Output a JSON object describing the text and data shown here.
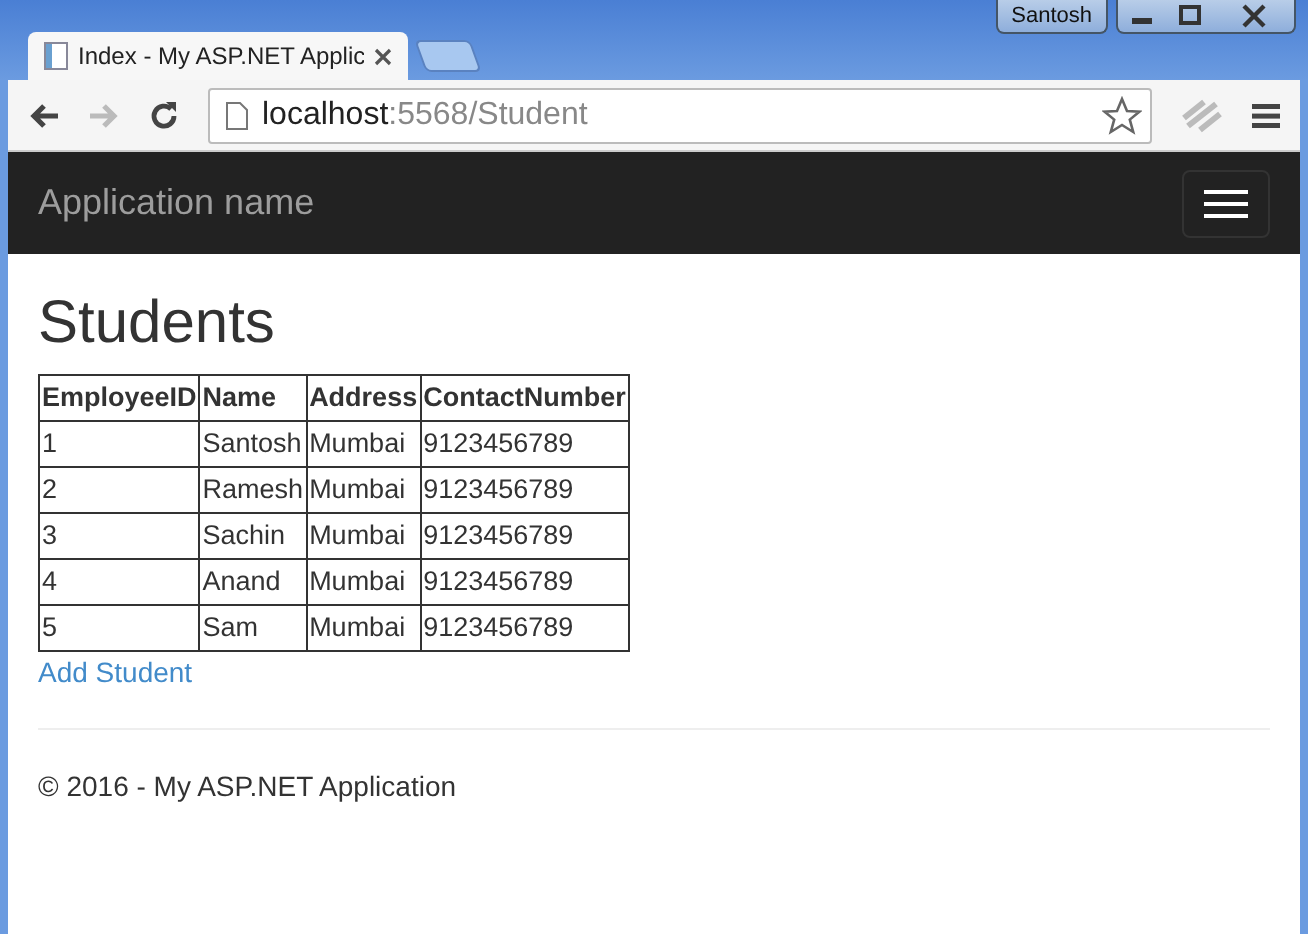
{
  "window": {
    "user": "Santosh"
  },
  "tabs": [
    {
      "kind": "page",
      "title": "Index - My ASP.NET Applic",
      "selected": true
    },
    {
      "kind": "new",
      "selected": false
    }
  ],
  "address": {
    "host": "localhost",
    "path": ":5568/Student"
  },
  "navbar": {
    "brand": "Application name"
  },
  "page": {
    "heading": "Students",
    "table": {
      "columns": [
        "EmployeeID",
        "Name",
        "Address",
        "ContactNumber"
      ],
      "rows": [
        [
          "1",
          "Santosh",
          "Mumbai",
          "9123456789"
        ],
        [
          "2",
          "Ramesh",
          "Mumbai",
          "9123456789"
        ],
        [
          "3",
          "Sachin",
          "Mumbai",
          "9123456789"
        ],
        [
          "4",
          "Anand",
          "Mumbai",
          "9123456789"
        ],
        [
          "5",
          "Sam",
          "Mumbai",
          "9123456789"
        ]
      ]
    },
    "link": "Add Student",
    "footer": "© 2016 - My ASP.NET Application"
  }
}
